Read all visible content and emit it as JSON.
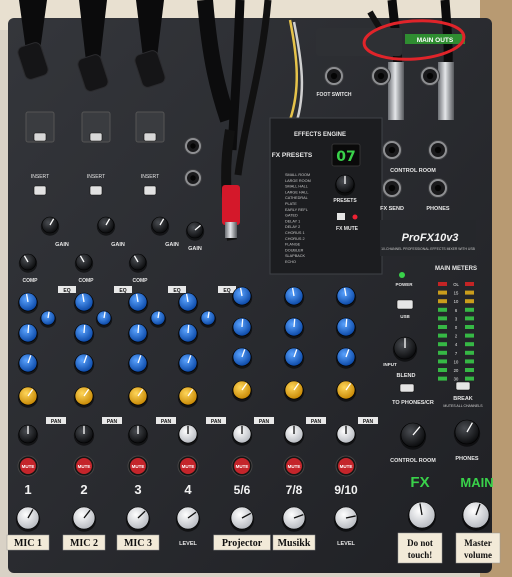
{
  "panel": {
    "main_outs_label": "MAIN OUTS",
    "foot_switch_label": "FOOT SWITCH",
    "effects_engine_label": "EFFECTS ENGINE",
    "fx_presets_title": "FX PRESETS",
    "presets_label": "PRESETS",
    "fx_mute_label": "FX MUTE",
    "preset_display": "07",
    "preset_list": [
      "SMALL ROOM",
      "LARGE ROOM",
      "SMALL HALL",
      "LARGE HALL",
      "CATHEDRAL",
      "PLATE",
      "EARLY REFL",
      "GATED",
      "DELAY 1",
      "DELAY 2",
      "CHORUS 1",
      "CHORUS 2",
      "FLANGE",
      "DOUBLER",
      "SLAPBACK",
      "ECHO"
    ],
    "control_room_label": "CONTROL ROOM",
    "phones_label": "PHONES",
    "fx_send_label": "FX SEND",
    "brand_name": "ProFX10v3",
    "brand_tagline": "10-CHANNEL PROFESSIONAL EFFECTS MIXER WITH USB",
    "power_label": "POWER",
    "main_meters_label": "MAIN METERS",
    "meter_scale": [
      "OL",
      "15",
      "10",
      "6",
      "3",
      "0",
      "2",
      "4",
      "7",
      "10",
      "20",
      "30"
    ],
    "usb_label": "USB",
    "blend_label": "BLEND",
    "input_label": "INPUT",
    "to_phones_label": "TO PHONES/CR",
    "break_label": "BREAK",
    "break_sub": "MUTES ALL CHANNELS",
    "control_room_knob_label": "CONTROL ROOM",
    "phones_knob_label": "PHONES",
    "fx_master_label": "FX",
    "main_master_label": "MAIN",
    "line_in_label": "LINE IN 8",
    "mute_label": "MUTE",
    "pan_label": "PAN",
    "eq_label": "EQ",
    "gain_label": "GAIN",
    "comp_label": "COMP",
    "insert_label": "INSERT",
    "level_label": "LEVEL"
  },
  "channels": [
    {
      "number": "1",
      "tape": "MIC 1"
    },
    {
      "number": "2",
      "tape": "MIC 2"
    },
    {
      "number": "3",
      "tape": "MIC 3"
    },
    {
      "number": "4",
      "tape": ""
    },
    {
      "number": "5/6",
      "tape": "Projector"
    },
    {
      "number": "7/8",
      "tape": "Musikk"
    },
    {
      "number": "9/10",
      "tape": ""
    }
  ],
  "master_tapes": {
    "fx": "Do not touch!",
    "main": "Master volume"
  },
  "annotation": {
    "color": "#e0242a",
    "shape": "ellipse-highlight",
    "target": "main-outs-label"
  },
  "colors": {
    "panel": "#2a2c30",
    "knob_blue": "#1f6fd8",
    "knob_yellow": "#f2b21a",
    "mute_red": "#c4252b",
    "green_accent": "#39d24a",
    "tape": "#f2ead8"
  }
}
